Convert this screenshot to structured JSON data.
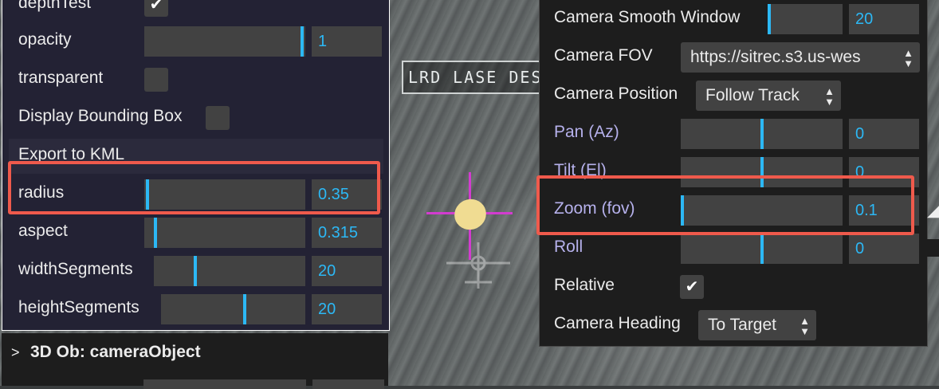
{
  "video": {
    "overlay_text": "LRD LASE DES"
  },
  "left_panel": {
    "depth_test": {
      "label": "depthTest",
      "checked": true
    },
    "opacity": {
      "label": "opacity",
      "value": "1"
    },
    "transparent": {
      "label": "transparent",
      "checked": false
    },
    "display_bbox": {
      "label": "Display Bounding Box",
      "checked": false
    },
    "export": {
      "label": "Export to KML"
    },
    "radius": {
      "label": "radius",
      "value": "0.35"
    },
    "aspect": {
      "label": "aspect",
      "value": "0.315"
    },
    "width_segments": {
      "label": "widthSegments",
      "value": "20"
    },
    "height_segments": {
      "label": "heightSegments",
      "value": "20"
    }
  },
  "folder": {
    "caret": ">",
    "title": "3D Ob: cameraObject"
  },
  "right_panel": {
    "smooth_window": {
      "label": "Camera Smooth Window",
      "value": "20"
    },
    "fov": {
      "label": "Camera FOV",
      "value": "https://sitrec.s3.us-wes"
    },
    "position": {
      "label": "Camera Position",
      "value": "Follow Track"
    },
    "pan": {
      "label": "Pan (Az)",
      "value": "0"
    },
    "tilt": {
      "label": "Tilt (El)",
      "value": "0"
    },
    "zoom": {
      "label": "Zoom (fov)",
      "value": "0.1"
    },
    "roll": {
      "label": "Roll",
      "value": "0"
    },
    "relative": {
      "label": "Relative",
      "checked": true
    },
    "heading": {
      "label": "Camera Heading",
      "value": "To Target"
    }
  },
  "icons": {
    "check": "✔",
    "select_arrows": "▲▼"
  },
  "colors": {
    "accent": "#2cb8f5",
    "highlight": "#ef5a4c",
    "reticle": "#d23ccf"
  }
}
